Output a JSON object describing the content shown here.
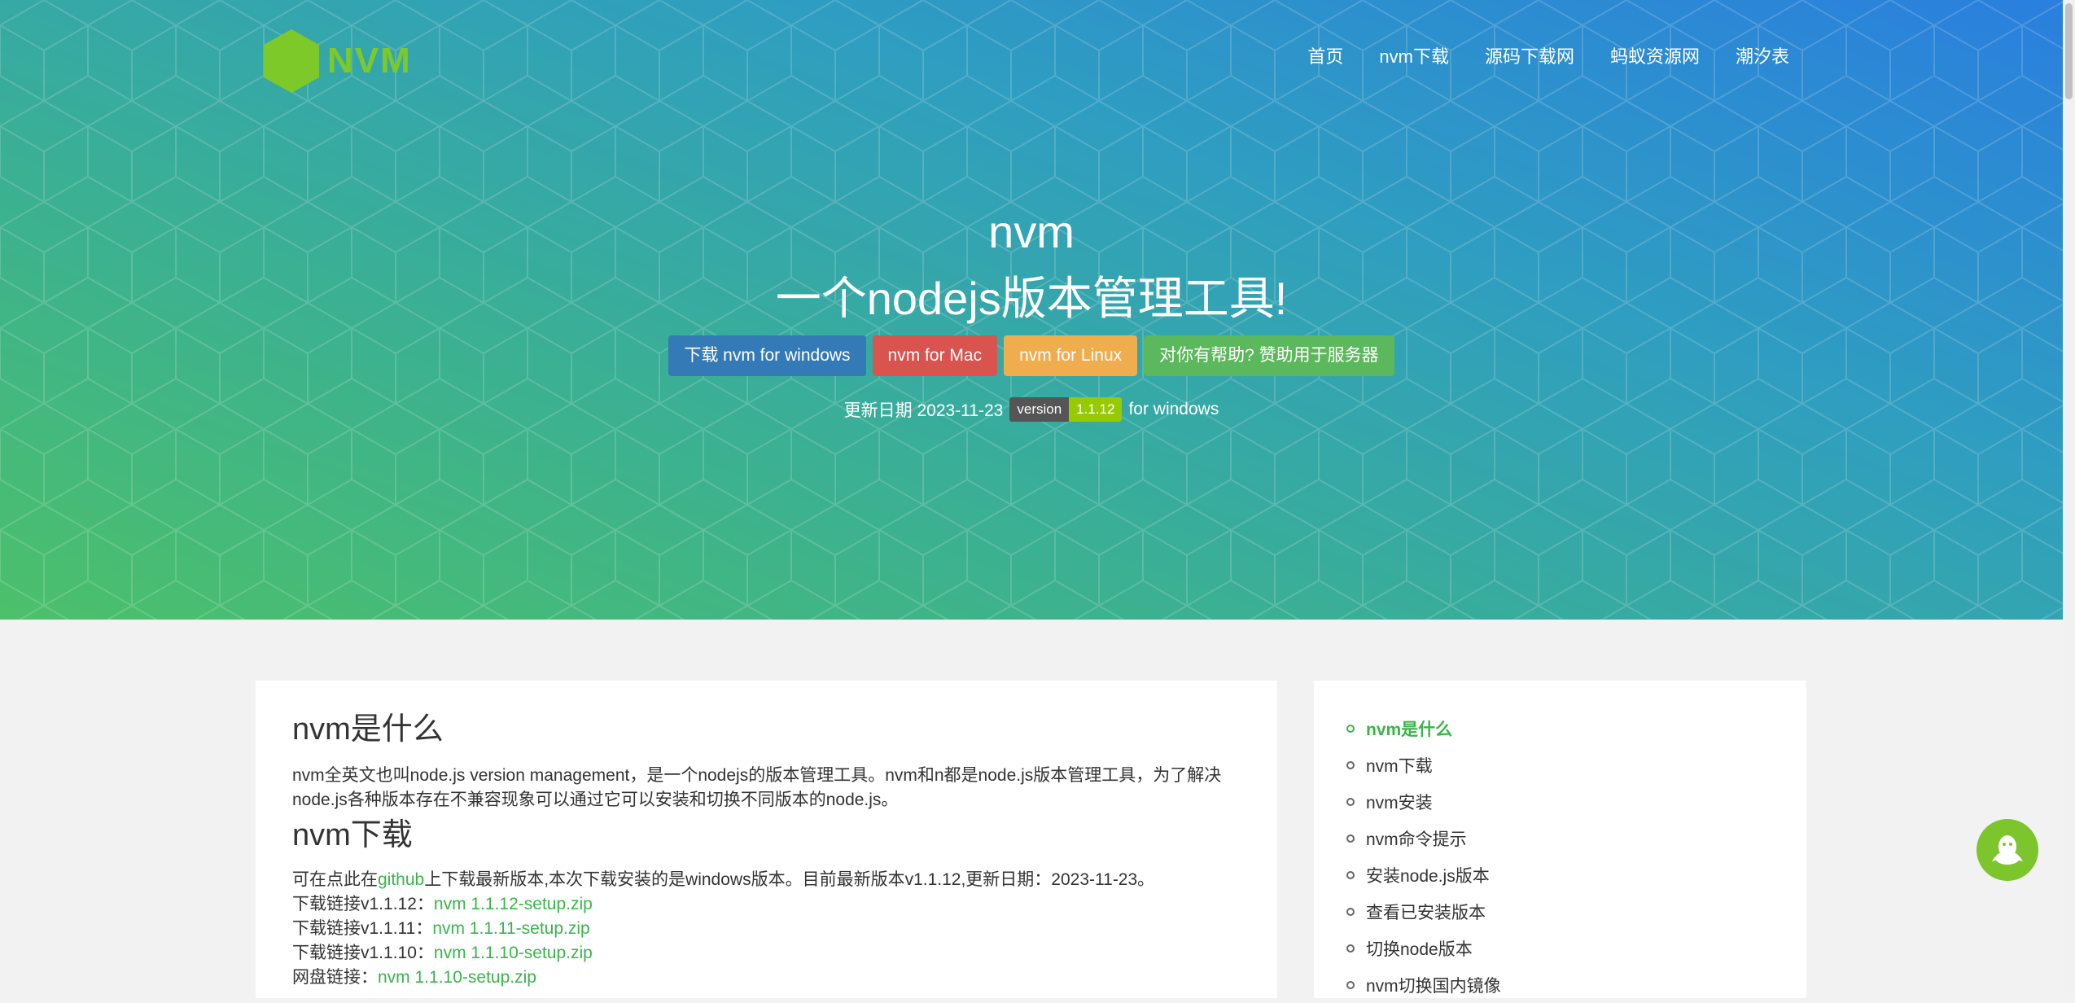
{
  "brand": {
    "logo_text": "NVM",
    "logo_color": "#7ec92a"
  },
  "nav": {
    "items": [
      "首页",
      "nvm下载",
      "源码下载网",
      "蚂蚁资源网",
      "潮汐表"
    ]
  },
  "hero": {
    "title": "nvm",
    "subtitle": "一个nodejs版本管理工具!",
    "buttons": [
      {
        "label": "下载 nvm for windows",
        "color": "#337ab7"
      },
      {
        "label": "nvm for Mac",
        "color": "#d9534f"
      },
      {
        "label": "nvm for Linux",
        "color": "#f0ad4e"
      },
      {
        "label": "对你有帮助? 赞助用于服务器",
        "color": "#5cb85c"
      }
    ],
    "update_prefix": "更新日期 2023-11-23",
    "badge_left": "version",
    "badge_right": "1.1.12",
    "update_suffix": "for windows"
  },
  "main": {
    "section1_title": "nvm是什么",
    "section1_text": "nvm全英文也叫node.js version management，是一个nodejs的版本管理工具。nvm和n都是node.js版本管理工具，为了解决node.js各种版本存在不兼容现象可以通过它可以安装和切换不同版本的node.js。",
    "section2_title": "nvm下载",
    "download_intro_pre": "可在点此在",
    "download_intro_link": "github",
    "download_intro_post": "上下载最新版本,本次下载安装的是windows版本。目前最新版本v1.1.12,更新日期：2023-11-23。",
    "links": [
      {
        "label": "下载链接v1.1.12：",
        "file": "nvm 1.1.12-setup.zip"
      },
      {
        "label": "下载链接v1.1.11：",
        "file": "nvm 1.1.11-setup.zip"
      },
      {
        "label": "下载链接v1.1.10：",
        "file": "nvm 1.1.10-setup.zip"
      },
      {
        "label": "网盘链接：",
        "file": "nvm 1.1.10-setup.zip"
      }
    ]
  },
  "toc": {
    "items": [
      "nvm是什么",
      "nvm下载",
      "nvm安装",
      "nvm命令提示",
      "安装node.js版本",
      "查看已安装版本",
      "切换node版本",
      "nvm切换国内镜像"
    ],
    "active_index": 0,
    "active_color": "#3ab54a"
  },
  "floating": {
    "icon": "qq-penguin-icon"
  }
}
